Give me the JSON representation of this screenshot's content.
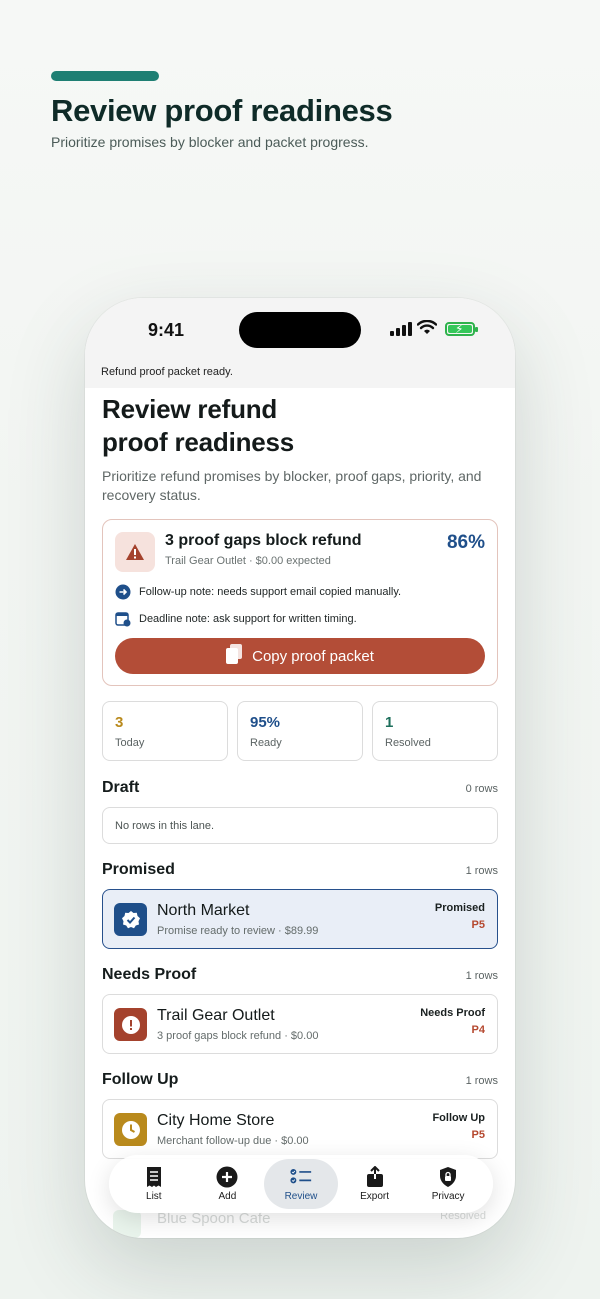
{
  "header": {
    "title": "Review proof readiness",
    "subtitle": "Prioritize promises by blocker and packet progress."
  },
  "status_bar": {
    "time": "9:41"
  },
  "banner": "Refund proof packet ready.",
  "screen": {
    "title_line1": "Review refund",
    "title_line2": "proof readiness",
    "subtitle": "Prioritize refund promises by blocker, proof gaps, priority, and recovery status."
  },
  "alert": {
    "title": "3 proof gaps block refund",
    "meta": "Trail Gear Outlet · $0.00 expected",
    "percent": "86%",
    "note1": "Follow-up note: needs support email copied manually.",
    "note2": "Deadline note: ask support for written timing.",
    "button_label": "Copy proof packet",
    "colors": {
      "accent": "#b34d37",
      "percent": "#1f4f8a"
    }
  },
  "stats": [
    {
      "value": "3",
      "label": "Today",
      "color": "#b98a1d"
    },
    {
      "value": "95%",
      "label": "Ready",
      "color": "#1f4f8a"
    },
    {
      "value": "1",
      "label": "Resolved",
      "color": "#1e6f5c"
    }
  ],
  "lanes": {
    "draft": {
      "title": "Draft",
      "count": "0 rows",
      "empty": "No rows in this lane."
    },
    "promised": {
      "title": "Promised",
      "count": "1 rows",
      "row": {
        "name": "North Market",
        "sub": "Promise ready to review · $89.99",
        "status": "Promised",
        "priority": "P5",
        "icon": "verified-badge-icon"
      }
    },
    "needs_proof": {
      "title": "Needs Proof",
      "count": "1 rows",
      "row": {
        "name": "Trail Gear Outlet",
        "sub": "3 proof gaps block refund · $0.00",
        "status": "Needs Proof",
        "priority": "P4",
        "icon": "alert-circle-icon"
      }
    },
    "follow_up": {
      "title": "Follow Up",
      "count": "1 rows",
      "row": {
        "name": "City Home Store",
        "sub": "Merchant follow-up due · $0.00",
        "status": "Follow Up",
        "priority": "P5",
        "icon": "clock-icon"
      }
    },
    "resolved_peek": {
      "name": "Blue Spoon Cafe",
      "status": "Resolved"
    }
  },
  "tabs": [
    {
      "label": "List",
      "icon": "receipt-list-icon"
    },
    {
      "label": "Add",
      "icon": "plus-circle-icon"
    },
    {
      "label": "Review",
      "icon": "checklist-icon",
      "active": true
    },
    {
      "label": "Export",
      "icon": "share-icon"
    },
    {
      "label": "Privacy",
      "icon": "lock-shield-icon"
    }
  ]
}
